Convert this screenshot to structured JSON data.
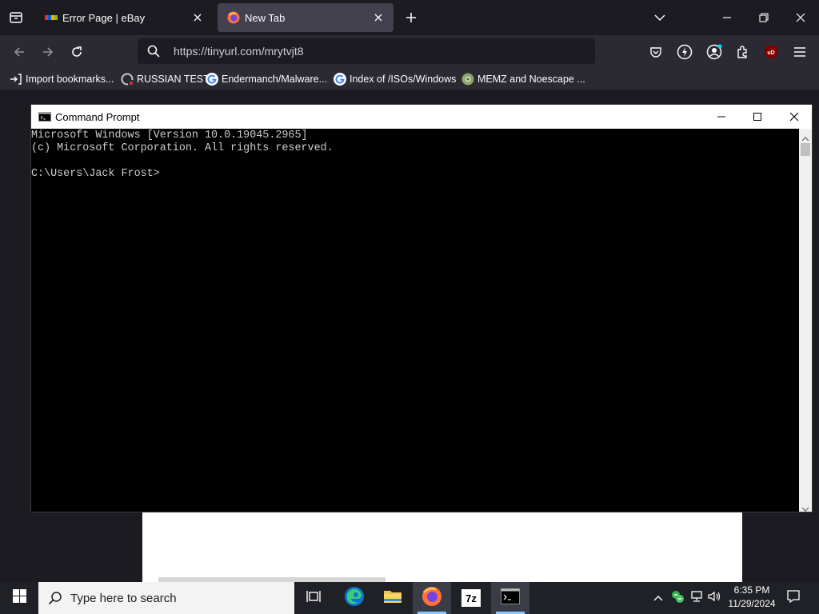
{
  "browser": {
    "tabs": [
      {
        "title": "Error Page | eBay",
        "active": false
      },
      {
        "title": "New Tab",
        "active": true
      }
    ],
    "url": "https://tinyurl.com/mrytvjt8",
    "bookmarks": [
      {
        "label": "Import bookmarks...",
        "icon": "import-icon"
      },
      {
        "label": "RUSSIAN TEST",
        "icon": "russian-site-icon"
      },
      {
        "label": "Endermanch/Malware...",
        "icon": "google-icon"
      },
      {
        "label": "Index of /ISOs/Windows",
        "icon": "google-icon"
      },
      {
        "label": "MEMZ and Noescape ...",
        "icon": "memz-icon"
      }
    ],
    "extension_badge": "uD"
  },
  "cmd": {
    "title": "Command Prompt",
    "lines": [
      "Microsoft Windows [Version 10.0.19045.2965]",
      "(c) Microsoft Corporation. All rights reserved.",
      "",
      "C:\\Users\\Jack Frost>"
    ]
  },
  "taskbar": {
    "search_placeholder": "Type here to search",
    "time": "6:35 PM",
    "date": "11/29/2024",
    "pinned": [
      "task-view-icon",
      "edge-icon",
      "file-explorer-icon",
      "firefox-icon",
      "7zip-icon",
      "cmd-icon"
    ],
    "zip_label": "7z"
  },
  "colors": {
    "browser_bg": "#1c1b22",
    "toolbar": "#2b2a33",
    "active_tab": "#42414d",
    "taskbar": "#1f2127"
  }
}
